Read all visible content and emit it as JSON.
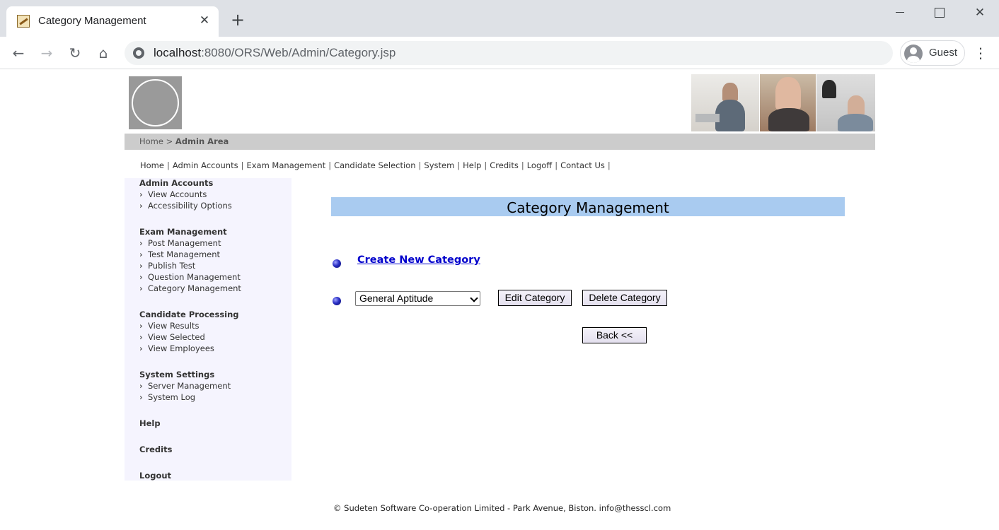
{
  "browser": {
    "tab_title": "Category Management",
    "tab_close": "✕",
    "new_tab": "+",
    "url_host": "localhost",
    "url_path": ":8080/ORS/Web/Admin/Category.jsp",
    "profile_label": "Guest",
    "icons": {
      "back": "back-arrow-icon",
      "forward": "forward-arrow-icon",
      "reload": "reload-icon",
      "home": "home-icon",
      "site_info": "site-info-icon",
      "menu": "kebab-menu-icon"
    }
  },
  "breadcrumb": {
    "home": "Home",
    "separator": " > ",
    "current": "Admin Area"
  },
  "topnav": {
    "items": [
      "Home",
      "Admin Accounts",
      "Exam Management",
      "Candidate Selection",
      "System",
      "Help",
      "Credits",
      "Logoff",
      "Contact Us"
    ],
    "separator": "|"
  },
  "sidebar": {
    "sections": [
      {
        "heading": "Admin Accounts",
        "items": [
          "View Accounts",
          "Accessibility Options"
        ]
      },
      {
        "heading": "Exam Management",
        "items": [
          "Post Management",
          "Test Management",
          "Publish Test",
          "Question Management",
          "Category Management"
        ]
      },
      {
        "heading": "Candidate Processing",
        "items": [
          "View Results",
          "View Selected",
          "View Employees"
        ]
      },
      {
        "heading": "System Settings",
        "items": [
          "Server Management",
          "System Log"
        ]
      },
      {
        "heading": "Help",
        "items": []
      },
      {
        "heading": "Credits",
        "items": []
      },
      {
        "heading": "Logout",
        "items": []
      }
    ]
  },
  "main": {
    "title": "Category Management",
    "create_link": "Create New Category",
    "category_select_value": "General Aptitude",
    "edit_button": "Edit Category",
    "delete_button": "Delete Category",
    "back_button": "Back <<"
  },
  "footer": {
    "text": "© Sudeten Software Co-operation Limited - Park Avenue, Biston. info@thesscl.com"
  },
  "colors": {
    "title_bar": "#a9cbf0",
    "sidebar_bg": "#f5f4fe",
    "crumb_bar": "#cccccc",
    "link": "#0000cc"
  }
}
